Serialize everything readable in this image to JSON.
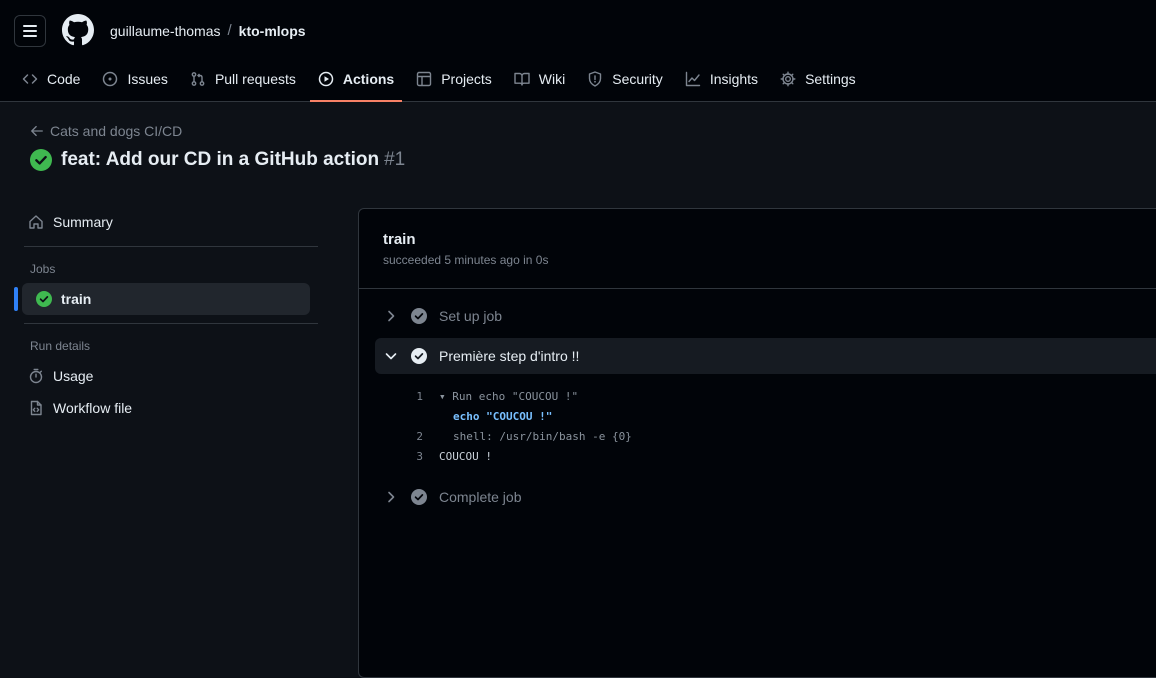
{
  "header": {
    "owner": "guillaume-thomas",
    "separator": "/",
    "repo": "kto-mlops",
    "tabs": [
      {
        "label": "Code",
        "icon": "code-icon"
      },
      {
        "label": "Issues",
        "icon": "issue-icon"
      },
      {
        "label": "Pull requests",
        "icon": "pull-request-icon"
      },
      {
        "label": "Actions",
        "icon": "play-icon",
        "active": true
      },
      {
        "label": "Projects",
        "icon": "table-icon"
      },
      {
        "label": "Wiki",
        "icon": "book-icon"
      },
      {
        "label": "Security",
        "icon": "shield-icon"
      },
      {
        "label": "Insights",
        "icon": "graph-icon"
      },
      {
        "label": "Settings",
        "icon": "gear-icon"
      }
    ]
  },
  "run": {
    "workflow_name": "Cats and dogs CI/CD",
    "title": "feat: Add our CD in a GitHub action",
    "number": "#1"
  },
  "sidebar": {
    "summary_label": "Summary",
    "jobs_heading": "Jobs",
    "jobs": [
      {
        "label": "train"
      }
    ],
    "run_details_heading": "Run details",
    "usage_label": "Usage",
    "workflow_file_label": "Workflow file"
  },
  "job": {
    "name": "train",
    "status": "succeeded 5 minutes ago in 0s",
    "steps": [
      {
        "label": "Set up job"
      },
      {
        "label": "Première step d'intro !!"
      },
      {
        "label": "Complete job"
      }
    ],
    "log": [
      {
        "num": "1",
        "text": "▾ Run echo \"COUCOU !\""
      },
      {
        "num": "",
        "text": "echo \"COUCOU !\""
      },
      {
        "num": "2",
        "text": "shell: /usr/bin/bash -e {0}"
      },
      {
        "num": "3",
        "text": "COUCOU !"
      }
    ]
  },
  "colors": {
    "success": "#3fb950",
    "active_tab_underline": "#f78166",
    "selected_marker": "#2f81f7"
  }
}
